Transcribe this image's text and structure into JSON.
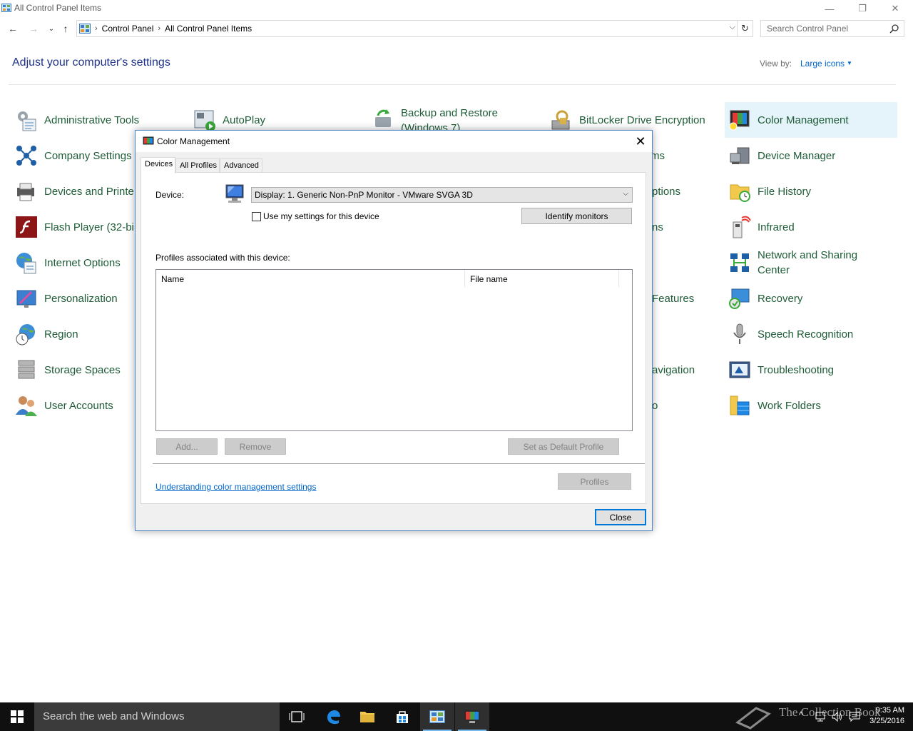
{
  "window": {
    "title": "All Control Panel Items",
    "minimize": "—",
    "maximize": "❐",
    "close": "✕"
  },
  "nav": {
    "back": "←",
    "forward": "→",
    "recent": "⌄",
    "up": "↑",
    "breadcrumbs": [
      "Control Panel",
      "All Control Panel Items"
    ],
    "crumb_separator": "›",
    "refresh": "↻",
    "search_placeholder": "Search Control Panel"
  },
  "header": {
    "heading": "Adjust your computer's settings",
    "view_by_label": "View by:",
    "view_by_value": "Large icons",
    "view_by_arrow": "▼"
  },
  "items": {
    "administrative_tools": "Administrative Tools",
    "autoplay": "AutoPlay",
    "backup_restore": "Backup and Restore (Windows 7)",
    "bitlocker": "BitLocker Drive Encryption",
    "color_management": "Color Management",
    "company_settings": "Company Settings",
    "col4_row2": "ms",
    "device_manager": "Device Manager",
    "devices_printers": "Devices and Printe",
    "col4_row3": "ptions",
    "file_history": "File History",
    "flash_player": "Flash Player (32-bi",
    "col4_row4": "ns",
    "infrared": "Infrared",
    "internet_options": "Internet Options",
    "network_sharing": "Network and Sharing Center",
    "personalization": "Personalization",
    "col4_row6": "Features",
    "recovery": "Recovery",
    "region": "Region",
    "speech_recognition": "Speech Recognition",
    "storage_spaces": "Storage Spaces",
    "col4_row8": "avigation",
    "troubleshooting": "Troubleshooting",
    "user_accounts": "User Accounts",
    "col4_row9": "o",
    "work_folders": "Work Folders"
  },
  "dialog": {
    "title": "Color Management",
    "close_glyph": "✕",
    "tabs": [
      "Devices",
      "All Profiles",
      "Advanced"
    ],
    "device_label": "Device:",
    "device_value": "Display: 1. Generic Non-PnP Monitor - VMware SVGA 3D",
    "device_caret": "⌵",
    "use_my_settings": "Use my settings for this device",
    "identify_monitors": "Identify monitors",
    "profiles_label": "Profiles associated with this device:",
    "columns": [
      "Name",
      "File name"
    ],
    "add": "Add...",
    "remove": "Remove",
    "set_default": "Set as Default Profile",
    "link": "Understanding color management settings",
    "profiles": "Profiles",
    "close_button": "Close"
  },
  "taskbar": {
    "search_placeholder": "Search the web and Windows",
    "watermark": "The Collection Book",
    "time": "9:35 AM",
    "date": "3/25/2016"
  },
  "colors": {
    "link_green": "#1e5c36",
    "heading_blue": "#1e3287",
    "accent": "#0078d7",
    "selected_bg": "#e5f3fb"
  }
}
